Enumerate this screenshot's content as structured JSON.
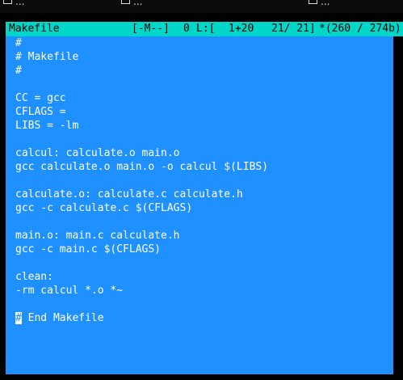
{
  "window": {
    "tabs": [
      {
        "label": "..."
      },
      {
        "label": "..."
      },
      {
        "label": "..."
      }
    ]
  },
  "statusbar": {
    "filename": "Makefile",
    "mode": "[-M--]",
    "col": "0",
    "line_label": "L:[",
    "range": "1+20",
    "position": "21/ 21]",
    "size": "*(260 / 274b)"
  },
  "editor": {
    "lines": [
      "#",
      "# Makefile",
      "#",
      "",
      "CC = gcc",
      "CFLAGS =",
      "LIBS = -lm",
      "",
      "calcul: calculate.o main.o",
      "gcc calculate.o main.o -o calcul $(LIBS)",
      "",
      "calculate.o: calculate.c calculate.h",
      "gcc -c calculate.c $(CFLAGS)",
      "",
      "main.o: main.c calculate.h",
      "gcc -c main.c $(CFLAGS)",
      "",
      "clean:",
      "-rm calcul *.o *~",
      "",
      "#",
      " End Makefile"
    ]
  },
  "colors": {
    "editor_bg": "#1e90ff",
    "status_bg": "#00d7c8",
    "text": "#ffffff"
  }
}
